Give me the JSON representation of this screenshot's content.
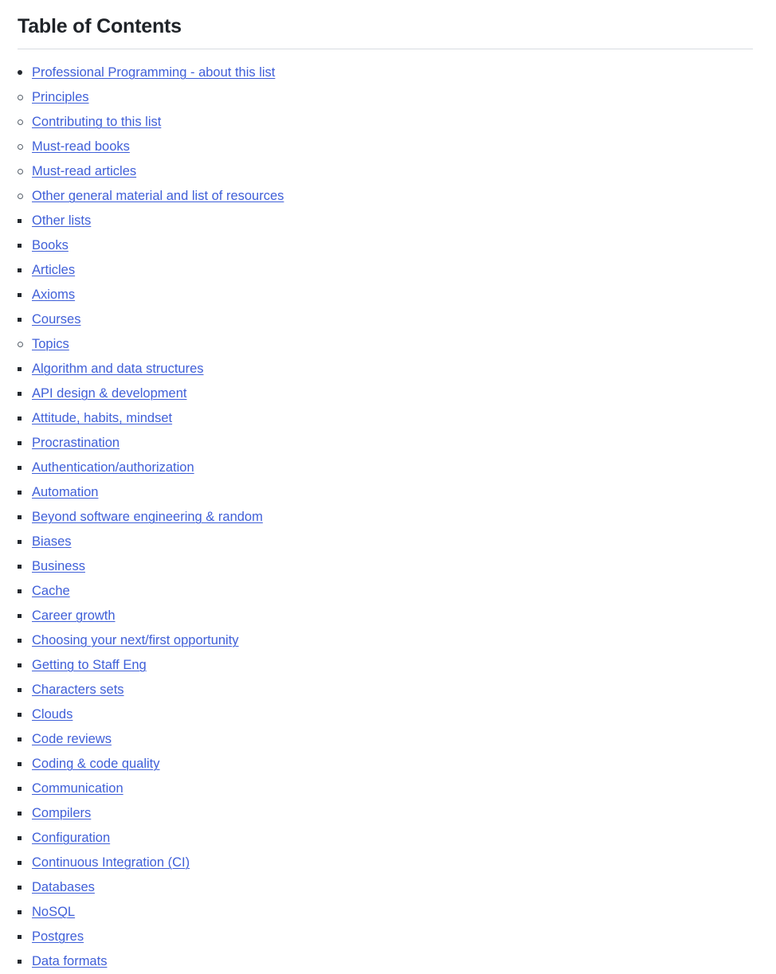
{
  "page": {
    "title": "Table of Contents"
  },
  "bullet_glyphs": {
    "level_1": "disc",
    "level_2": "circle",
    "level_3": "square",
    "level_4": "square"
  },
  "colors": {
    "link": "#3f5fd8",
    "text": "#1f2328",
    "divider": "#d8dce1",
    "background": "#ffffff"
  },
  "toc": [
    {
      "label": "Professional Programming - about this list",
      "children": [
        {
          "label": "Principles",
          "children": []
        },
        {
          "label": "Contributing to this list",
          "children": []
        },
        {
          "label": "Must-read books",
          "children": []
        },
        {
          "label": "Must-read articles",
          "children": []
        },
        {
          "label": "Other general material and list of resources",
          "children": [
            {
              "label": "Other lists",
              "children": []
            },
            {
              "label": "Books",
              "children": []
            },
            {
              "label": "Articles",
              "children": []
            },
            {
              "label": "Axioms",
              "children": []
            },
            {
              "label": "Courses",
              "children": []
            }
          ]
        },
        {
          "label": "Topics",
          "children": [
            {
              "label": "Algorithm and data structures",
              "children": []
            },
            {
              "label": "API design & development",
              "children": []
            },
            {
              "label": "Attitude, habits, mindset",
              "children": [
                {
                  "label": "Procrastination",
                  "children": []
                }
              ]
            },
            {
              "label": "Authentication/authorization",
              "children": []
            },
            {
              "label": "Automation",
              "children": []
            },
            {
              "label": "Beyond software engineering & random",
              "children": []
            },
            {
              "label": "Biases",
              "children": []
            },
            {
              "label": "Business",
              "children": []
            },
            {
              "label": "Cache",
              "children": []
            },
            {
              "label": "Career growth",
              "children": [
                {
                  "label": "Choosing your next/first opportunity",
                  "children": []
                },
                {
                  "label": "Getting to Staff Eng",
                  "children": []
                }
              ]
            },
            {
              "label": "Characters sets",
              "children": []
            },
            {
              "label": "Clouds",
              "children": []
            },
            {
              "label": "Code reviews",
              "children": []
            },
            {
              "label": "Coding & code quality",
              "children": []
            },
            {
              "label": "Communication",
              "children": []
            },
            {
              "label": "Compilers",
              "children": []
            },
            {
              "label": "Configuration",
              "children": []
            },
            {
              "label": "Continuous Integration (CI)",
              "children": []
            },
            {
              "label": "Databases",
              "children": [
                {
                  "label": "NoSQL",
                  "children": []
                },
                {
                  "label": "Postgres",
                  "children": []
                }
              ]
            },
            {
              "label": "Data formats",
              "children": []
            }
          ]
        }
      ]
    }
  ]
}
